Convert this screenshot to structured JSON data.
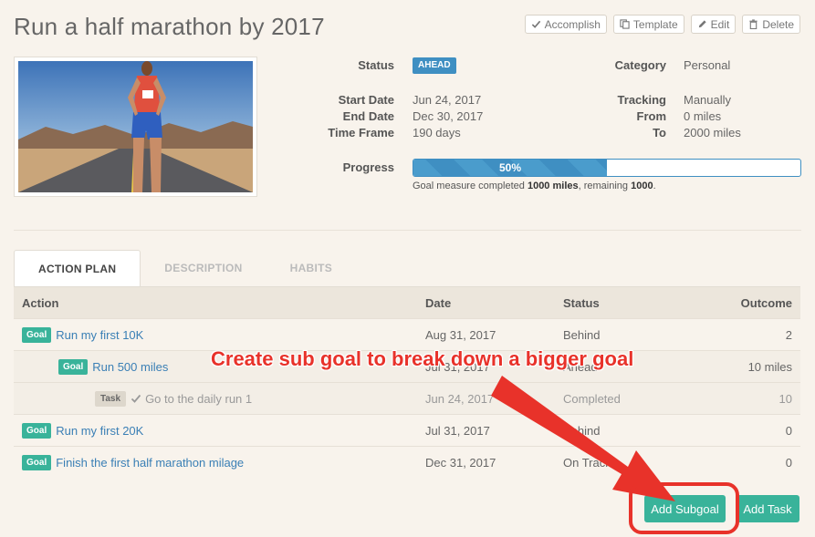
{
  "goal": {
    "title": "Run a half marathon by 2017"
  },
  "toolbar": {
    "accomplish_label": "Accomplish",
    "template_label": "Template",
    "edit_label": "Edit",
    "delete_label": "Delete"
  },
  "details": {
    "status_label": "Status",
    "status_value": "AHEAD",
    "start_date_label": "Start Date",
    "start_date_value": "Jun 24, 2017",
    "end_date_label": "End Date",
    "end_date_value": "Dec 30, 2017",
    "time_frame_label": "Time Frame",
    "time_frame_value": "190 days",
    "category_label": "Category",
    "category_value": "Personal",
    "tracking_label": "Tracking",
    "tracking_value": "Manually",
    "from_label": "From",
    "from_value": "0 miles",
    "to_label": "To",
    "to_value": "2000 miles",
    "progress_label": "Progress",
    "progress_percent": 50,
    "progress_text": "50%",
    "progress_note_prefix": "Goal measure completed ",
    "progress_note_completed": "1000 miles",
    "progress_note_middle": ", remaining ",
    "progress_note_remaining": "1000",
    "progress_note_suffix": "."
  },
  "tabs": [
    {
      "label": "ACTION PLAN",
      "active": true
    },
    {
      "label": "DESCRIPTION",
      "active": false
    },
    {
      "label": "HABITS",
      "active": false
    }
  ],
  "table": {
    "headers": {
      "action": "Action",
      "date": "Date",
      "status": "Status",
      "outcome": "Outcome"
    },
    "rows": [
      {
        "tag": "Goal",
        "name": "Run my first 10K",
        "date": "Aug 31, 2017",
        "status": "Behind",
        "outcome": "2"
      },
      {
        "tag": "Goal",
        "name": "Run 500 miles",
        "date": "Jul 31, 2017",
        "status": "Ahead",
        "outcome": "10 miles"
      },
      {
        "tag": "Task",
        "name": "Go to the daily run 1",
        "date": "Jun 24, 2017",
        "status": "Completed",
        "outcome": "10"
      },
      {
        "tag": "Goal",
        "name": "Run my first 20K",
        "date": "Jul 31, 2017",
        "status": "Behind",
        "outcome": "0"
      },
      {
        "tag": "Goal",
        "name": "Finish the first half marathon milage",
        "date": "Dec 31, 2017",
        "status": "On Track",
        "outcome": "0"
      }
    ]
  },
  "buttons": {
    "add_subgoal": "Add Subgoal",
    "add_task": "Add Task"
  },
  "annotation": {
    "callout": "Create sub goal to break down a bigger goal"
  },
  "colors": {
    "accent": "#39b39a",
    "progress": "#3f8fc2",
    "callout": "#e8322a",
    "link": "#3a7fb5"
  },
  "icons": [
    "check-icon",
    "template-icon",
    "pencil-icon",
    "trash-icon"
  ]
}
